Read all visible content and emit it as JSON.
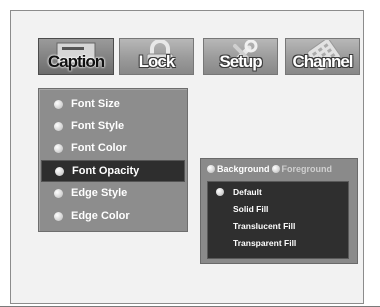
{
  "tabs": [
    {
      "id": "caption",
      "label": "Caption",
      "icon": "caption-icon",
      "active": true
    },
    {
      "id": "lock",
      "label": "Lock",
      "icon": "padlock-icon",
      "active": false
    },
    {
      "id": "setup",
      "label": "Setup",
      "icon": "tools-icon",
      "active": false
    },
    {
      "id": "channel",
      "label": "Channel",
      "icon": "keypad-icon",
      "active": false
    }
  ],
  "menu": {
    "items": [
      {
        "label": "Font Size",
        "selected": false
      },
      {
        "label": "Font Style",
        "selected": false
      },
      {
        "label": "Font Color",
        "selected": false
      },
      {
        "label": "Font Opacity",
        "selected": true
      },
      {
        "label": "Edge Style",
        "selected": false
      },
      {
        "label": "Edge Color",
        "selected": false
      }
    ]
  },
  "submenu": {
    "tabs": [
      {
        "label": "Background",
        "active": true
      },
      {
        "label": "Foreground",
        "active": false
      }
    ],
    "options": [
      {
        "label": "Default",
        "selected": true
      },
      {
        "label": "Solid Fill",
        "selected": false
      },
      {
        "label": "Translucent Fill",
        "selected": false
      },
      {
        "label": "Transparent Fill",
        "selected": false
      }
    ]
  },
  "colors": {
    "panel_bg": "#f2f2f2",
    "menu_bg": "#8d8d8d",
    "selected_bg": "#2e2e2e",
    "text": "#ffffff"
  }
}
